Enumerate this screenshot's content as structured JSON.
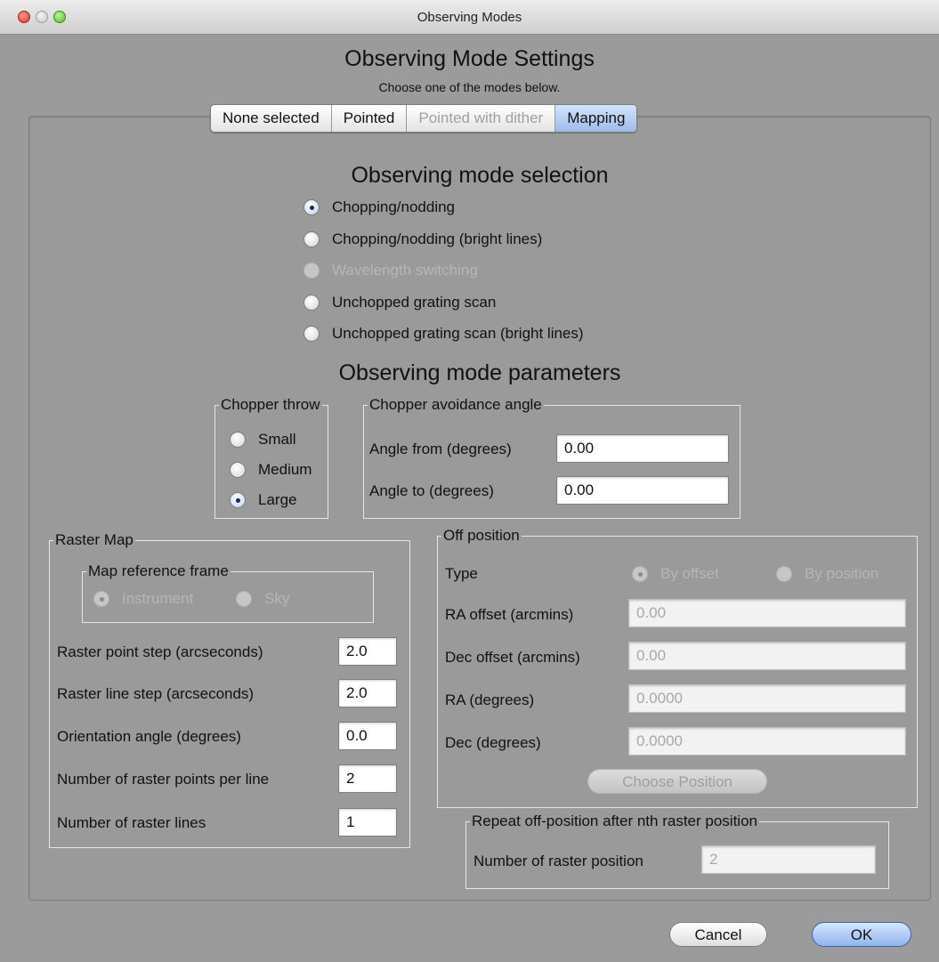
{
  "window": {
    "title": "Observing Modes"
  },
  "header": {
    "title": "Observing Mode Settings",
    "subtitle": "Choose one of the modes below."
  },
  "tabs": [
    {
      "label": "None selected",
      "state": "normal"
    },
    {
      "label": "Pointed",
      "state": "normal"
    },
    {
      "label": "Pointed with dither",
      "state": "disabled"
    },
    {
      "label": "Mapping",
      "state": "selected"
    }
  ],
  "mode_selection": {
    "title": "Observing mode selection",
    "options": [
      {
        "label": "Chopping/nodding",
        "selected": true
      },
      {
        "label": "Chopping/nodding (bright lines)",
        "selected": false
      },
      {
        "label": "Wavelength switching",
        "selected": false,
        "disabled": true
      },
      {
        "label": "Unchopped grating scan",
        "selected": false
      },
      {
        "label": "Unchopped grating scan (bright lines)",
        "selected": false
      }
    ]
  },
  "parameters": {
    "title": "Observing mode parameters",
    "chopper_throw": {
      "label": "Chopper throw",
      "options": [
        {
          "label": "Small",
          "selected": false
        },
        {
          "label": "Medium",
          "selected": false
        },
        {
          "label": "Large",
          "selected": true
        }
      ]
    },
    "chopper_avoidance": {
      "label": "Chopper avoidance angle",
      "angle_from_label": "Angle from (degrees)",
      "angle_from_value": "0.00",
      "angle_to_label": "Angle to (degrees)",
      "angle_to_value": "0.00"
    }
  },
  "raster_map": {
    "label": "Raster Map",
    "frame": {
      "label": "Map reference frame",
      "instrument": "Instrument",
      "sky": "Sky"
    },
    "point_step_label": "Raster point step (arcseconds)",
    "point_step_value": "2.0",
    "line_step_label": "Raster line step (arcseconds)",
    "line_step_value": "2.0",
    "orientation_label": "Orientation angle (degrees)",
    "orientation_value": "0.0",
    "points_per_line_label": "Number of raster points per line",
    "points_per_line_value": "2",
    "lines_label": "Number of raster lines",
    "lines_value": "1"
  },
  "off_position": {
    "label": "Off position",
    "type_label": "Type",
    "by_offset": "By offset",
    "by_position": "By position",
    "ra_offset_label": "RA offset (arcmins)",
    "ra_offset_value": "0.00",
    "dec_offset_label": "Dec offset (arcmins)",
    "dec_offset_value": "0.00",
    "ra_label": "RA (degrees)",
    "ra_value": "0.0000",
    "dec_label": "Dec (degrees)",
    "dec_value": "0.0000",
    "choose_position": "Choose Position"
  },
  "repeat": {
    "label": "Repeat off-position after nth raster position",
    "count_label": "Number of raster position",
    "count_value": "2"
  },
  "footer": {
    "cancel": "Cancel",
    "ok": "OK"
  }
}
